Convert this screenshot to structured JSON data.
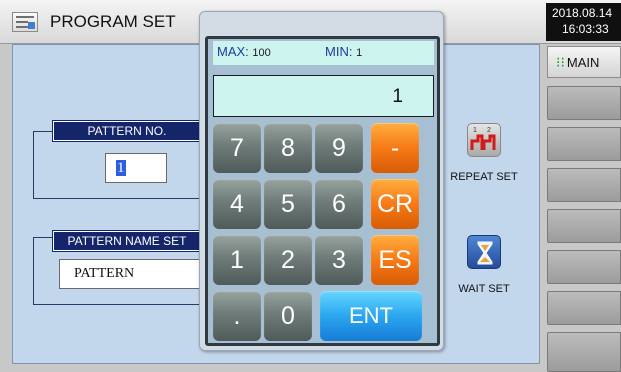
{
  "header": {
    "title": "PROGRAM SET",
    "date": "2018.08.14",
    "time": "16:03:33"
  },
  "pattern_no": {
    "label": "PATTERN NO.",
    "value": "1"
  },
  "pattern_name": {
    "label": "PATTERN NAME SET",
    "value": "PATTERN"
  },
  "tools": {
    "repeat_label": "REPEAT SET",
    "wait_label": "WAIT SET",
    "repeat_icon_numbers": [
      "1",
      "2"
    ]
  },
  "menu": {
    "main_label": "MAIN"
  },
  "keypad": {
    "max_label": "MAX:",
    "max_value": "100",
    "min_label": "MIN:",
    "min_value": "1",
    "display": "1",
    "keys": {
      "k7": "7",
      "k8": "8",
      "k9": "9",
      "minus": "-",
      "k4": "4",
      "k5": "5",
      "k6": "6",
      "cr": "CR",
      "k1": "1",
      "k2": "2",
      "k3": "3",
      "es": "ES",
      "dot": ".",
      "k0": "0",
      "ent": "ENT"
    }
  },
  "colors": {
    "content_bg": "#c2d6ec",
    "group_label_bg": "#14256a",
    "key_orange": "#f67a16",
    "key_blue": "#2aa6ef",
    "display_bg": "#cdf4ef"
  }
}
